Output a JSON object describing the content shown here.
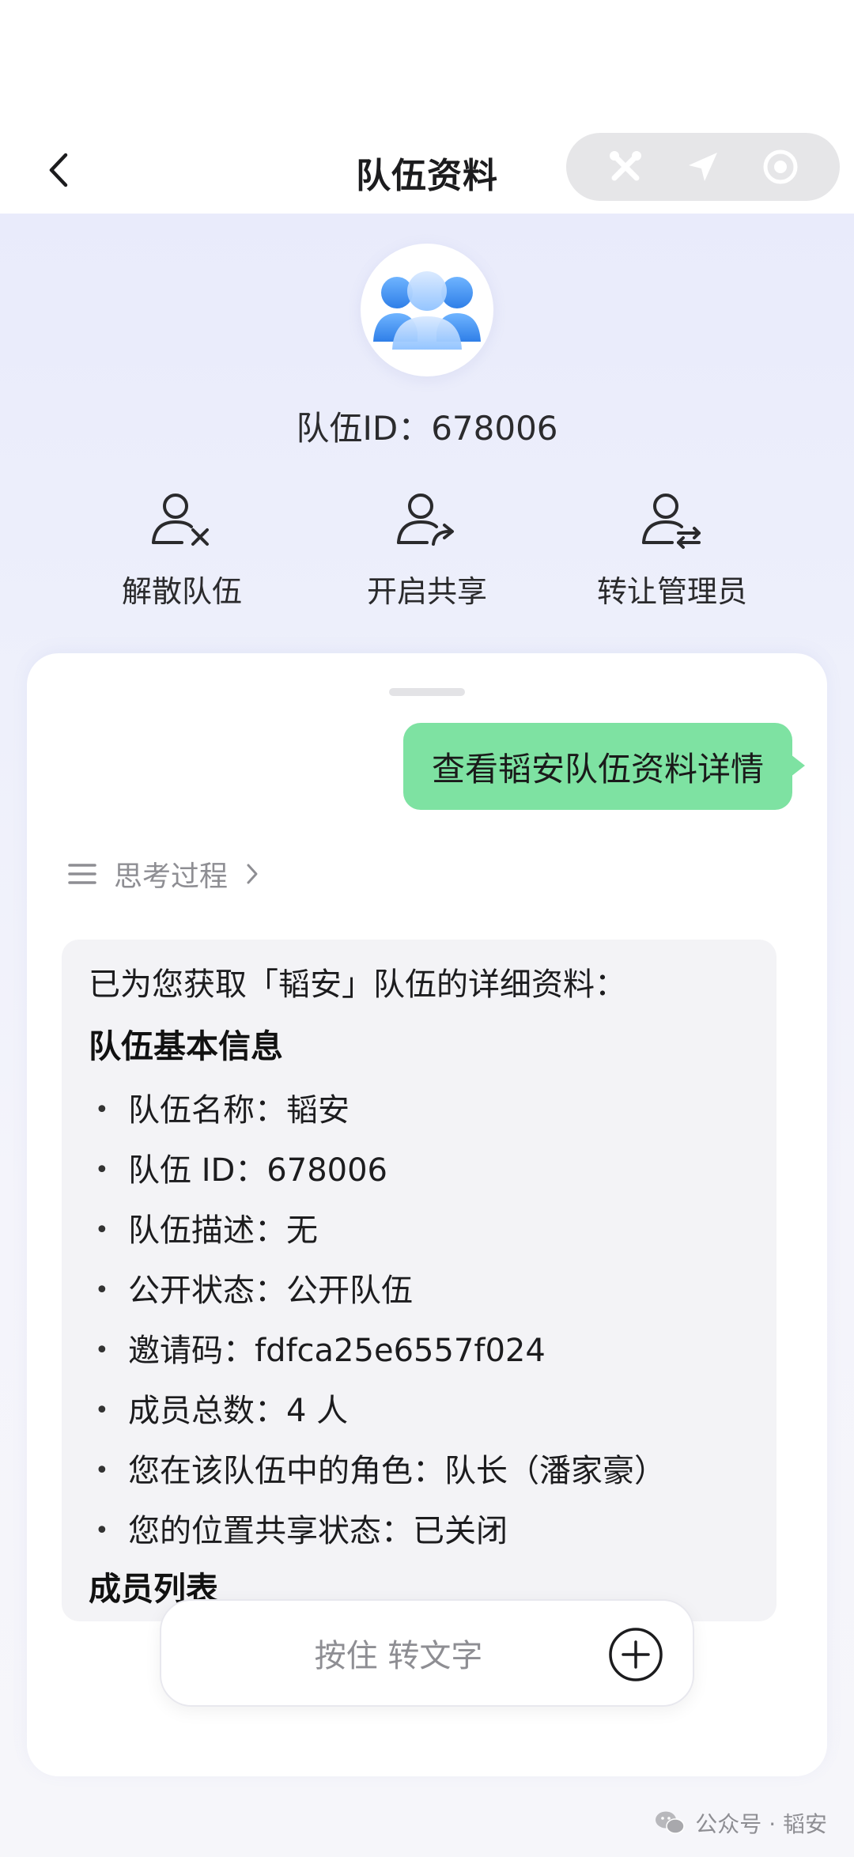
{
  "header": {
    "title": "队伍资料",
    "team_id_text": "队伍ID：678006"
  },
  "actions": [
    {
      "label": "解散队伍",
      "icon": "disband-team-icon"
    },
    {
      "label": "开启共享",
      "icon": "share-team-icon"
    },
    {
      "label": "转让管理员",
      "icon": "transfer-admin-icon"
    }
  ],
  "chat": {
    "user_message": "查看韬安队伍资料详情",
    "thinking_label": "思考过程",
    "ai_intro": "已为您获取「韬安」队伍的详细资料：",
    "section_basic": "队伍基本信息",
    "basic_items": [
      "队伍名称：韬安",
      "队伍 ID：678006",
      "队伍描述：无",
      "公开状态：公开队伍",
      "邀请码：fdfca25e6557f024",
      "成员总数：4 人",
      "您在该队伍中的角色：队长（潘家豪）",
      "您的位置共享状态：已关闭"
    ],
    "section_members": "成员列表"
  },
  "input": {
    "label": "按住 转文字"
  },
  "watermark": {
    "text": "公众号 · 韬安"
  },
  "colors": {
    "user_bubble": "#7ee2a2",
    "ai_bubble": "#f3f3f6",
    "header_bg": "#e9ebfb",
    "avatar_blue": "#3b8cf0"
  }
}
